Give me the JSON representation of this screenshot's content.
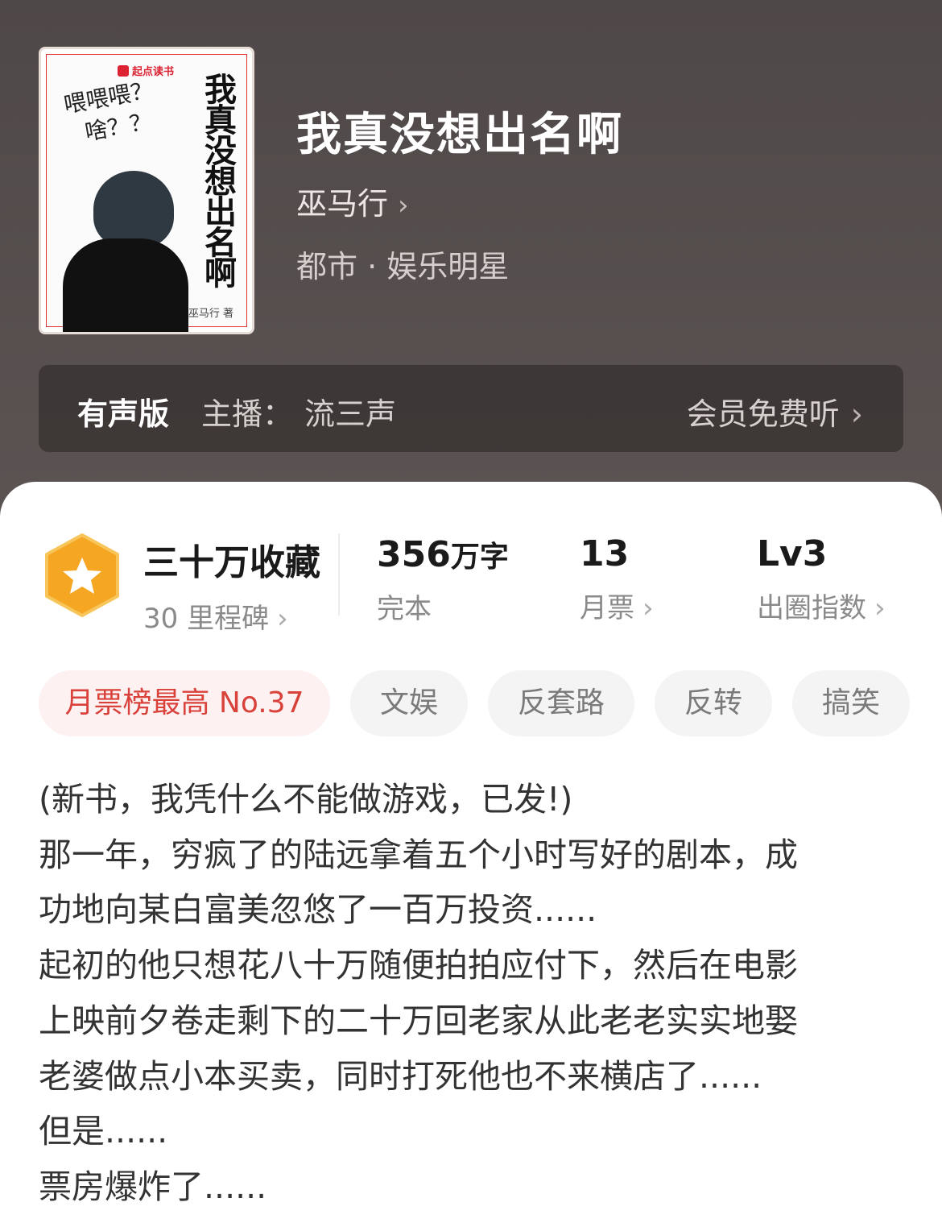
{
  "book": {
    "title": "我真没想出名啊",
    "author": "巫马行",
    "genre": "都市 · 娱乐明星"
  },
  "cover": {
    "brand": "起点读书",
    "title_vertical": "我真没想出名啊",
    "doodle_line1": "喂喂喂？",
    "doodle_line2": "啥？？",
    "author_credit": "巫马行 著"
  },
  "audio": {
    "label": "有声版",
    "host_label": "主播：",
    "host": "流三声",
    "cta": "会员免费听"
  },
  "stats": {
    "collect_title": "三十万收藏",
    "collect_sub": "30 里程碑",
    "words_num": "356",
    "words_unit": "万字",
    "status": "完本",
    "votes_num": "13",
    "votes_label": "月票",
    "level": "Lv3",
    "level_label": "出圈指数"
  },
  "tags": [
    "月票榜最高 No.37",
    "文娱",
    "反套路",
    "反转",
    "搞笑"
  ],
  "description": [
    "(新书，我凭什么不能做游戏，已发!)",
    "那一年，穷疯了的陆远拿着五个小时写好的剧本，成",
    "功地向某白富美忽悠了一百万投资......",
    "起初的他只想花八十万随便拍拍应付下，然后在电影",
    "上映前夕卷走剩下的二十万回老家从此老老实实地娶",
    "老婆做点小本买卖，同时打死他也不来横店了......",
    "但是......",
    "票房爆炸了......"
  ],
  "icons": {
    "chevron": "chevron-right-icon",
    "badge": "star-hexagon-icon"
  },
  "colors": {
    "accent_red": "#d9413b",
    "badge_orange": "#f5a623",
    "header_bg": "#544d4c"
  }
}
